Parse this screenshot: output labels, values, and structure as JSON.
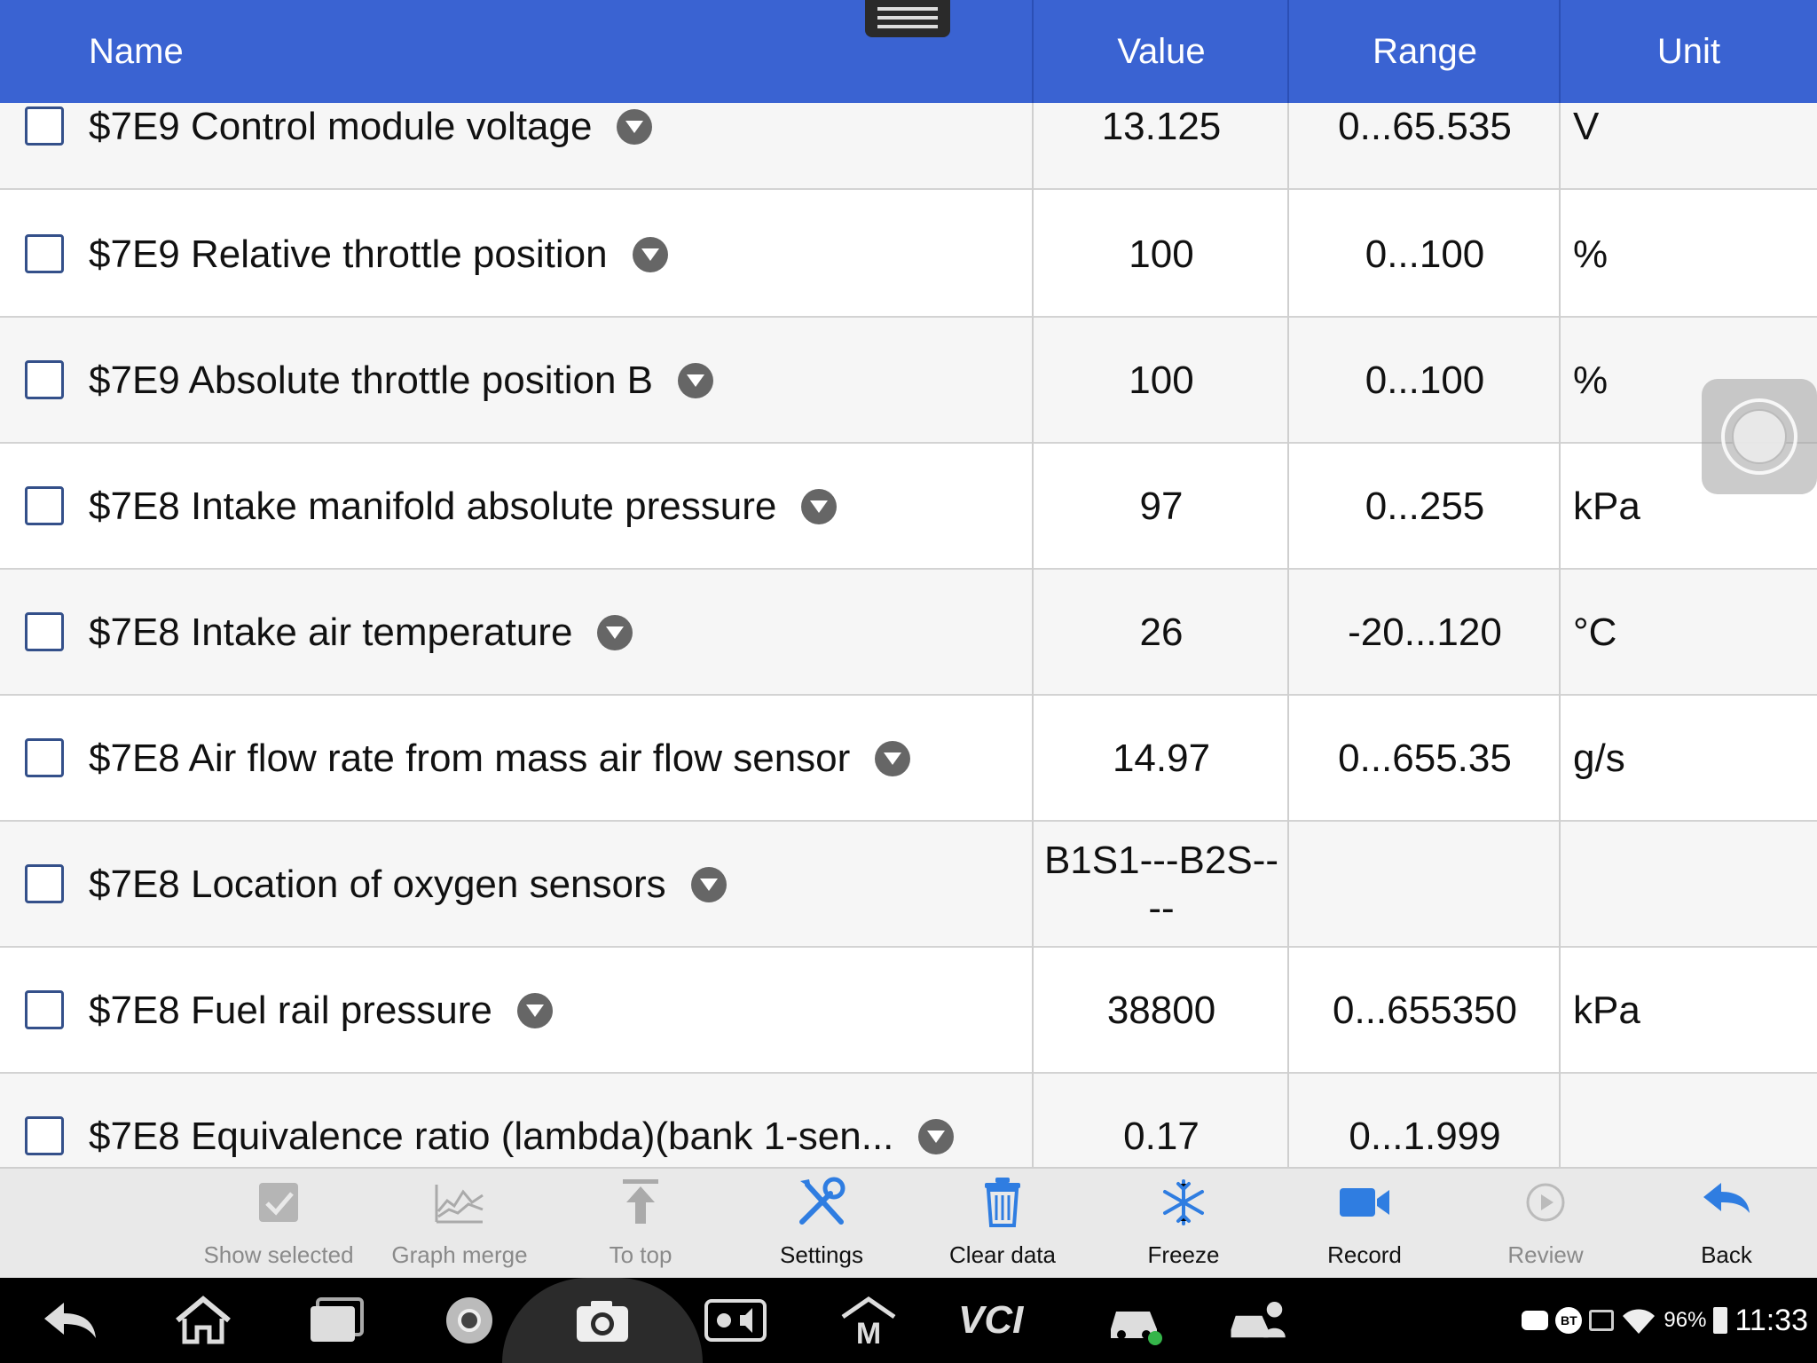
{
  "header": {
    "name": "Name",
    "value": "Value",
    "range": "Range",
    "unit": "Unit"
  },
  "rows": [
    {
      "name": "$7E9 Control module voltage",
      "value": "13.125",
      "range": "0...65.535",
      "unit": "V"
    },
    {
      "name": "$7E9 Relative throttle position",
      "value": "100",
      "range": "0...100",
      "unit": "%"
    },
    {
      "name": "$7E9 Absolute throttle position B",
      "value": "100",
      "range": "0...100",
      "unit": "%"
    },
    {
      "name": "$7E8 Intake manifold absolute pressure",
      "value": "97",
      "range": "0...255",
      "unit": "kPa"
    },
    {
      "name": "$7E8 Intake air temperature",
      "value": "26",
      "range": "-20...120",
      "unit": "°C"
    },
    {
      "name": "$7E8 Air flow rate from mass air flow sensor",
      "value": "14.97",
      "range": "0...655.35",
      "unit": "g/s"
    },
    {
      "name": "$7E8 Location of oxygen sensors",
      "value": "B1S1---B2S----",
      "range": "",
      "unit": ""
    },
    {
      "name": "$7E8 Fuel rail pressure",
      "value": "38800",
      "range": "0...655350",
      "unit": "kPa"
    },
    {
      "name": "$7E8 Equivalence ratio (lambda)(bank 1-sen...",
      "value": "0.17",
      "range": "0...1.999",
      "unit": ""
    }
  ],
  "toolbar": {
    "show_selected": "Show selected",
    "graph_merge": "Graph merge",
    "to_top": "To top",
    "settings": "Settings",
    "clear_data": "Clear data",
    "freeze": "Freeze",
    "record": "Record",
    "review": "Review",
    "back": "Back"
  },
  "status": {
    "battery": "96%",
    "time": "11:33",
    "bt": "BT",
    "vci": "VCI"
  },
  "colors": {
    "header": "#3a63d2",
    "accent_blue": "#2f7de1",
    "disabled": "#9a9a9a"
  }
}
